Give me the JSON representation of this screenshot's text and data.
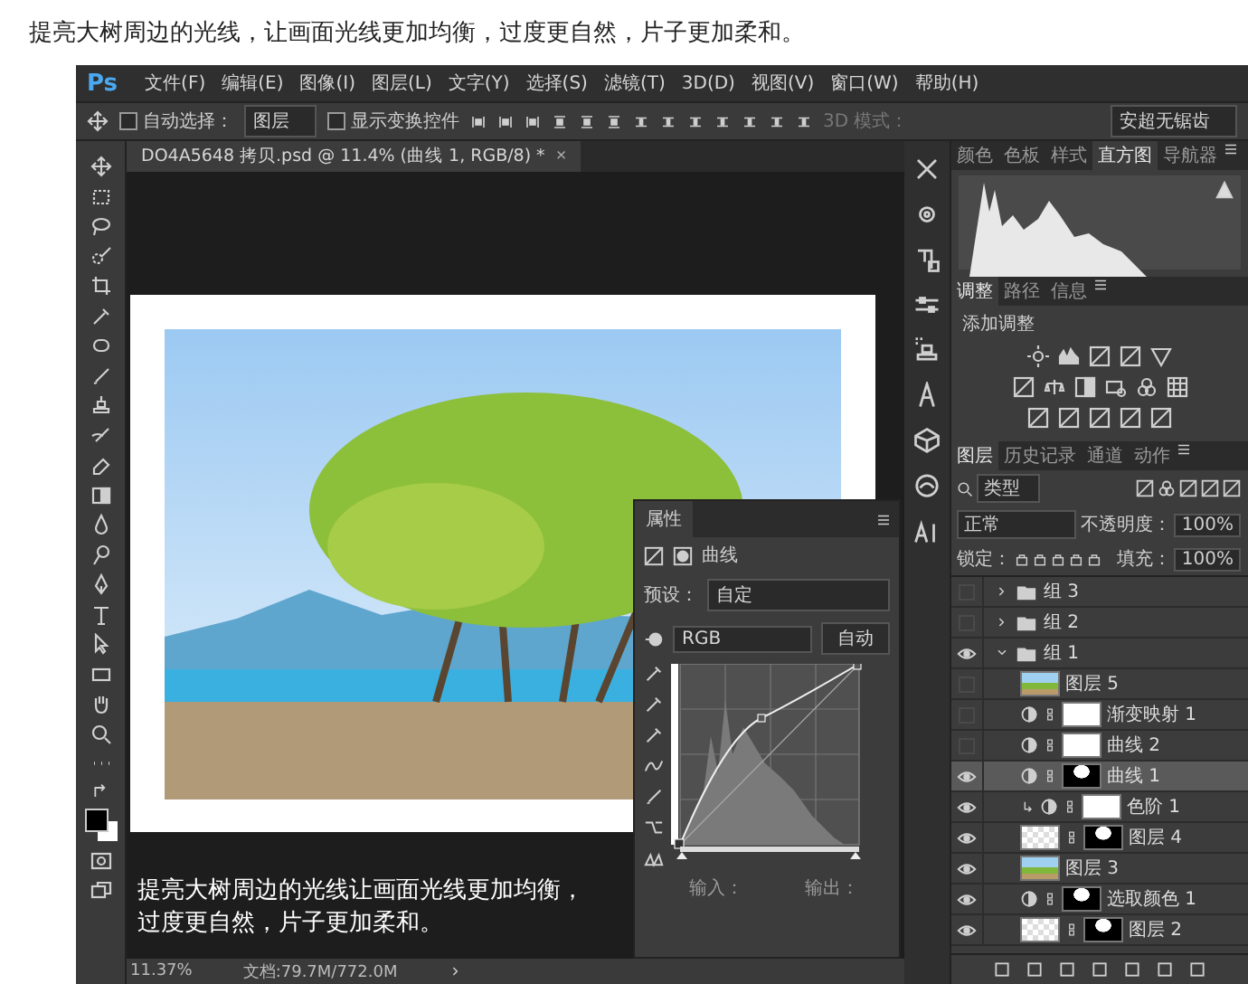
{
  "heading": "提亮大树周边的光线，让画面光线更加均衡，过度更自然，片子更加柔和。",
  "app": {
    "logo": "Ps",
    "menus": [
      "文件(F)",
      "编辑(E)",
      "图像(I)",
      "图层(L)",
      "文字(Y)",
      "选择(S)",
      "滤镜(T)",
      "3D(D)",
      "视图(V)",
      "窗口(W)",
      "帮助(H)"
    ]
  },
  "options_bar": {
    "auto_select": {
      "label": "自动选择：",
      "checked": false
    },
    "auto_select_target": "图层",
    "show_transform": {
      "label": "显示变换控件",
      "checked": false
    },
    "mode_3d": {
      "label": "3D 模式：",
      "disabled": true
    },
    "antialias": "安超无锯齿"
  },
  "document_tab": {
    "title": "DO4A5648 拷贝.psd @ 11.4% (曲线 1, RGB/8) *",
    "close": "×"
  },
  "canvas": {
    "caption_lines": [
      "提亮大树周边的光线让画面光线更加均衡，",
      "过度更自然，片子更加柔和。"
    ]
  },
  "status_bar": {
    "zoom": "11.37%",
    "doc_size": "文档:79.7M/772.0M"
  },
  "properties": {
    "title": "属性",
    "adjustment": "曲线",
    "preset_label": "预设：",
    "preset": "自定",
    "channel": "RGB",
    "auto_button": "自动",
    "input_label": "输入：",
    "output_label": "输出："
  },
  "histogram_panel": {
    "tabs": [
      {
        "label": "颜色",
        "selected": false
      },
      {
        "label": "色板",
        "selected": false
      },
      {
        "label": "样式",
        "selected": false
      },
      {
        "label": "直方图",
        "selected": true
      },
      {
        "label": "导航器",
        "selected": false
      }
    ]
  },
  "adjustments_panel": {
    "tabs": [
      {
        "label": "调整",
        "selected": true
      },
      {
        "label": "路径",
        "selected": false
      },
      {
        "label": "信息",
        "selected": false
      }
    ],
    "heading": "添加调整"
  },
  "layers_panel": {
    "tabs": [
      {
        "label": "图层",
        "selected": true
      },
      {
        "label": "历史记录",
        "selected": false
      },
      {
        "label": "通道",
        "selected": false
      },
      {
        "label": "动作",
        "selected": false
      }
    ],
    "filter": "类型",
    "blend_mode": "正常",
    "opacity_label": "不透明度：",
    "opacity": "100%",
    "lock_label": "锁定：",
    "fill_label": "填充：",
    "fill": "100%",
    "layers": [
      {
        "name": "组 3",
        "kind": "group",
        "visible": false,
        "selected": false,
        "expanded": false
      },
      {
        "name": "组 2",
        "kind": "group",
        "visible": false,
        "selected": false,
        "expanded": false
      },
      {
        "name": "组 1",
        "kind": "group",
        "visible": true,
        "selected": false,
        "expanded": true,
        "children": [
          {
            "name": "图层 5",
            "kind": "pixel",
            "transparent": false,
            "masked": false,
            "visible": false,
            "selected": false,
            "clipped": false
          },
          {
            "name": "渐变映射 1",
            "kind": "adjustment",
            "mask_painted": false,
            "visible": false,
            "selected": false,
            "clipped": false
          },
          {
            "name": "曲线 2",
            "kind": "adjustment",
            "mask_painted": false,
            "visible": false,
            "selected": false,
            "clipped": false
          },
          {
            "name": "曲线 1",
            "kind": "adjustment",
            "mask_painted": true,
            "visible": true,
            "selected": true,
            "clipped": false
          },
          {
            "name": "色阶 1",
            "kind": "adjustment",
            "mask_painted": false,
            "visible": true,
            "selected": false,
            "clipped": true
          },
          {
            "name": "图层 4",
            "kind": "pixel",
            "transparent": true,
            "masked": true,
            "visible": true,
            "selected": false,
            "clipped": false
          },
          {
            "name": "图层 3",
            "kind": "pixel",
            "transparent": false,
            "masked": false,
            "visible": true,
            "selected": false,
            "clipped": false
          },
          {
            "name": "选取颜色 1",
            "kind": "adjustment",
            "mask_painted": true,
            "visible": true,
            "selected": false,
            "clipped": false
          },
          {
            "name": "图层 2",
            "kind": "pixel",
            "transparent": true,
            "masked": true,
            "visible": true,
            "selected": false,
            "clipped": false
          }
        ]
      }
    ]
  }
}
